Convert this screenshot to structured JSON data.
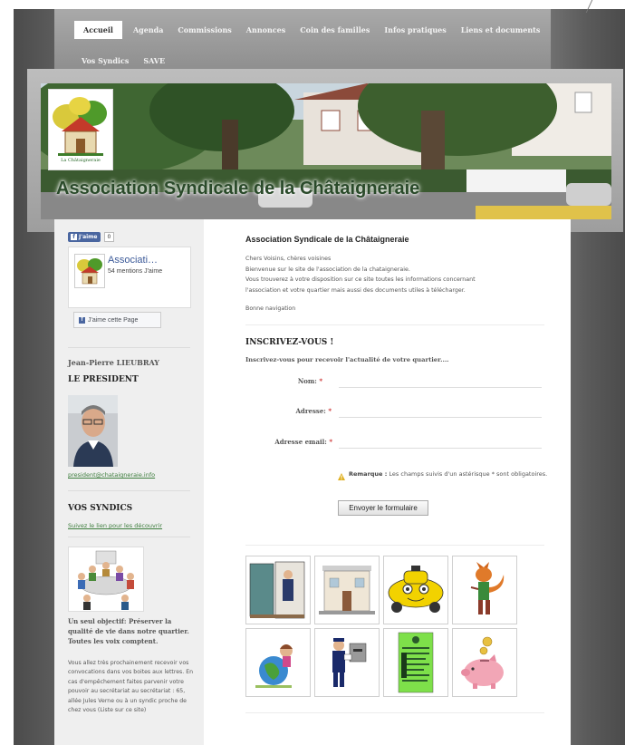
{
  "nav": {
    "items": [
      "Accueil",
      "Agenda",
      "Commissions",
      "Annonces",
      "Coin des familles",
      "Infos pratiques",
      "Liens et documents",
      "Vos Syndics",
      "SAVE"
    ],
    "active": "Accueil"
  },
  "banner": {
    "title": "Association Syndicale de la Châtaigneraie",
    "logo_caption": "La Châtaigneraie"
  },
  "facebook": {
    "like_label": "J'aime",
    "like_count": "0",
    "page_name": "Associati…",
    "page_likes": "54 mentions J'aime",
    "page_button": "J'aime cette Page"
  },
  "sidebar": {
    "president_name": "Jean-Pierre LIEUBRAY",
    "president_heading": "LE PRESIDENT",
    "president_email": "president@chataigneraie.info",
    "syndics_heading": "VOS SYNDICS",
    "syndics_link": "Suivez le lien pour les découvrir",
    "objective": "Un seul objectif: Préserver la qualité de vie dans notre quartier. Toutes les voix comptent.",
    "paragraph": "Vous allez très prochainement recevoir vos convocations dans vos boites aux lettres. En cas d'empêchement faites parvenir votre pouvoir au secrétariat au secrétariat : 65, allée Jules Verne ou à un syndic proche de chez vous (Liste sur ce site)"
  },
  "main": {
    "title": "Association Syndicale de la Châtaigneraie",
    "intro": [
      "Chers Voisins, chères voisines",
      "Bienvenue sur le site de l'association de la chataigneraie.",
      "Vous trouverez à votre disposition sur ce site toutes les informations concernant",
      "l'association et votre quartier mais aussi des documents utiles à télécharger."
    ],
    "sign": "Bonne navigation",
    "form": {
      "heading": "INSCRIVEZ-VOUS !",
      "subheading": "Inscrivez-vous pour recevoir l'actualité de votre quartier....",
      "name_label": "Nom:",
      "address_label": "Adresse:",
      "email_label": "Adresse email:",
      "required_mark": "*",
      "remark_label": "Remarque :",
      "remark_text": "Les champs suivis d'un astérisque * sont obligatoires.",
      "submit": "Envoyer le formulaire"
    }
  },
  "colors": {
    "link_green": "#3d7d3d",
    "facebook_blue": "#4a66a0",
    "nav_bg": "#9c9c9c"
  }
}
